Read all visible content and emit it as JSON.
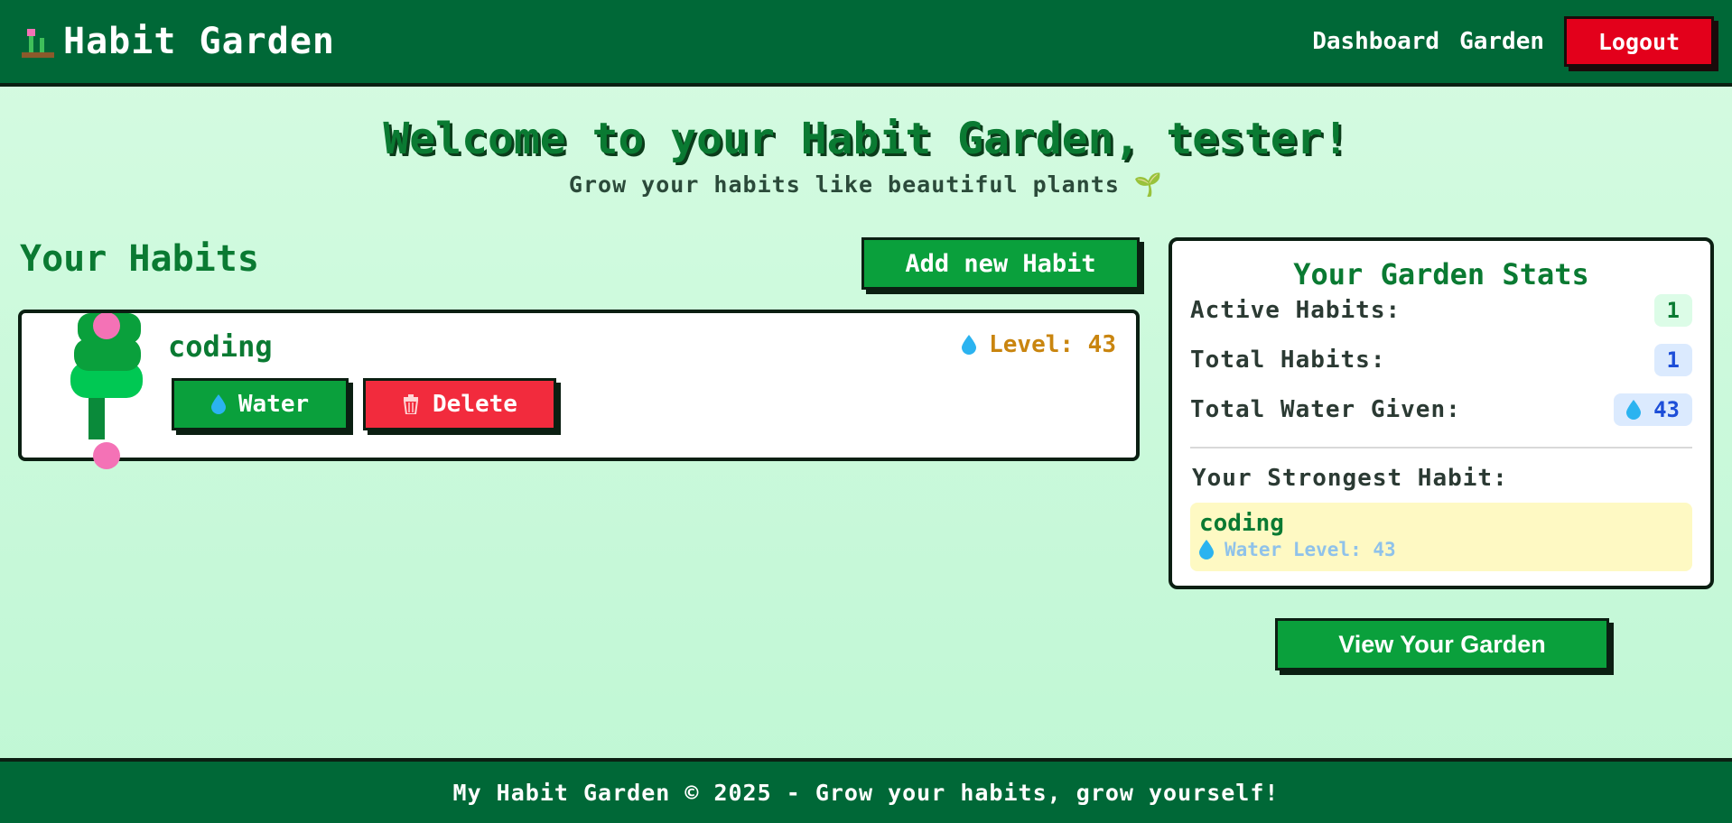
{
  "header": {
    "title": "Habit Garden",
    "logo_icon": "sprout-pixel-icon",
    "nav": [
      {
        "label": "Dashboard"
      },
      {
        "label": "Garden"
      }
    ],
    "logout_label": "Logout"
  },
  "hero": {
    "title": "Welcome to your Habit Garden, tester!",
    "subtitle": "Grow your habits like beautiful plants 🌱"
  },
  "habits": {
    "heading": "Your Habits",
    "add_label": "Add new Habit",
    "items": [
      {
        "name": "coding",
        "level_text": "Level: 43",
        "water_label": "Water",
        "delete_label": "Delete"
      }
    ]
  },
  "stats": {
    "title": "Your Garden Stats",
    "active_label": "Active Habits:",
    "active_value": "1",
    "total_label": "Total Habits:",
    "total_value": "1",
    "water_label": "Total Water Given:",
    "water_value": "43",
    "strongest_label": "Your Strongest Habit:",
    "strongest_name": "coding",
    "strongest_level": "Water Level: 43"
  },
  "view_garden_label": "View Your Garden",
  "footer": {
    "text": "My Habit Garden © 2025 - Grow your habits, grow yourself!"
  },
  "colors": {
    "header_bg": "#006837",
    "primary_button": "#0aa03c",
    "danger_button": "#f22b3d",
    "logout_button": "#e3001b",
    "level_text": "#c9850f"
  }
}
